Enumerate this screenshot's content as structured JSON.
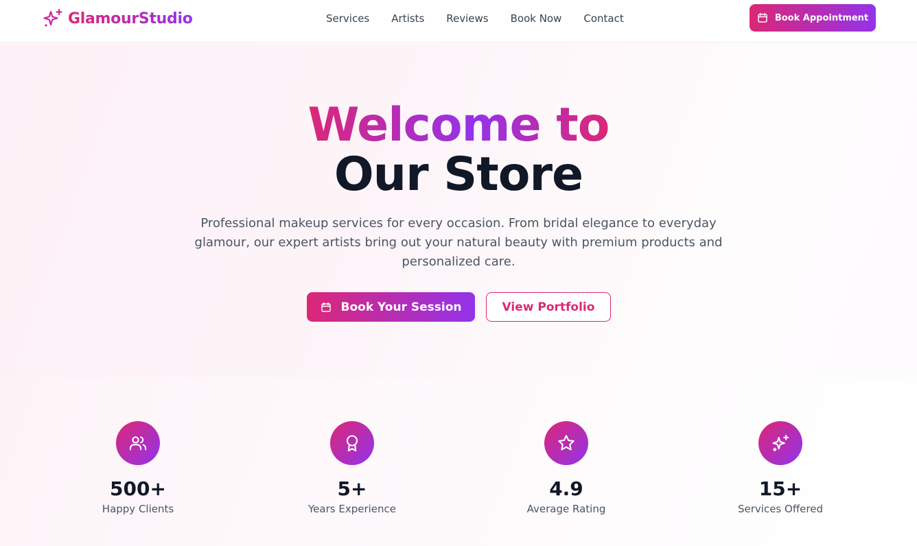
{
  "header": {
    "brand": "GlamourStudio",
    "nav": [
      "Services",
      "Artists",
      "Reviews",
      "Book Now",
      "Contact"
    ],
    "cta_label": "Book Appointment"
  },
  "hero": {
    "title_line1": "Welcome to",
    "title_line2": "Our Store",
    "subtitle": "Professional makeup services for every occasion. From bridal elegance to everyday glamour, our expert artists bring out your natural beauty with premium products and personalized care.",
    "primary_button": "Book Your Session",
    "secondary_button": "View Portfolio"
  },
  "stats": [
    {
      "icon": "users-icon",
      "value": "500+",
      "label": "Happy Clients"
    },
    {
      "icon": "award-icon",
      "value": "5+",
      "label": "Years Experience"
    },
    {
      "icon": "star-icon",
      "value": "4.9",
      "label": "Average Rating"
    },
    {
      "icon": "sparkles-icon",
      "value": "15+",
      "label": "Services Offered"
    }
  ],
  "colors": {
    "accent_start": "#db2777",
    "accent_end": "#9333ea",
    "text_dark": "#111827",
    "text_muted": "#4b5563"
  }
}
